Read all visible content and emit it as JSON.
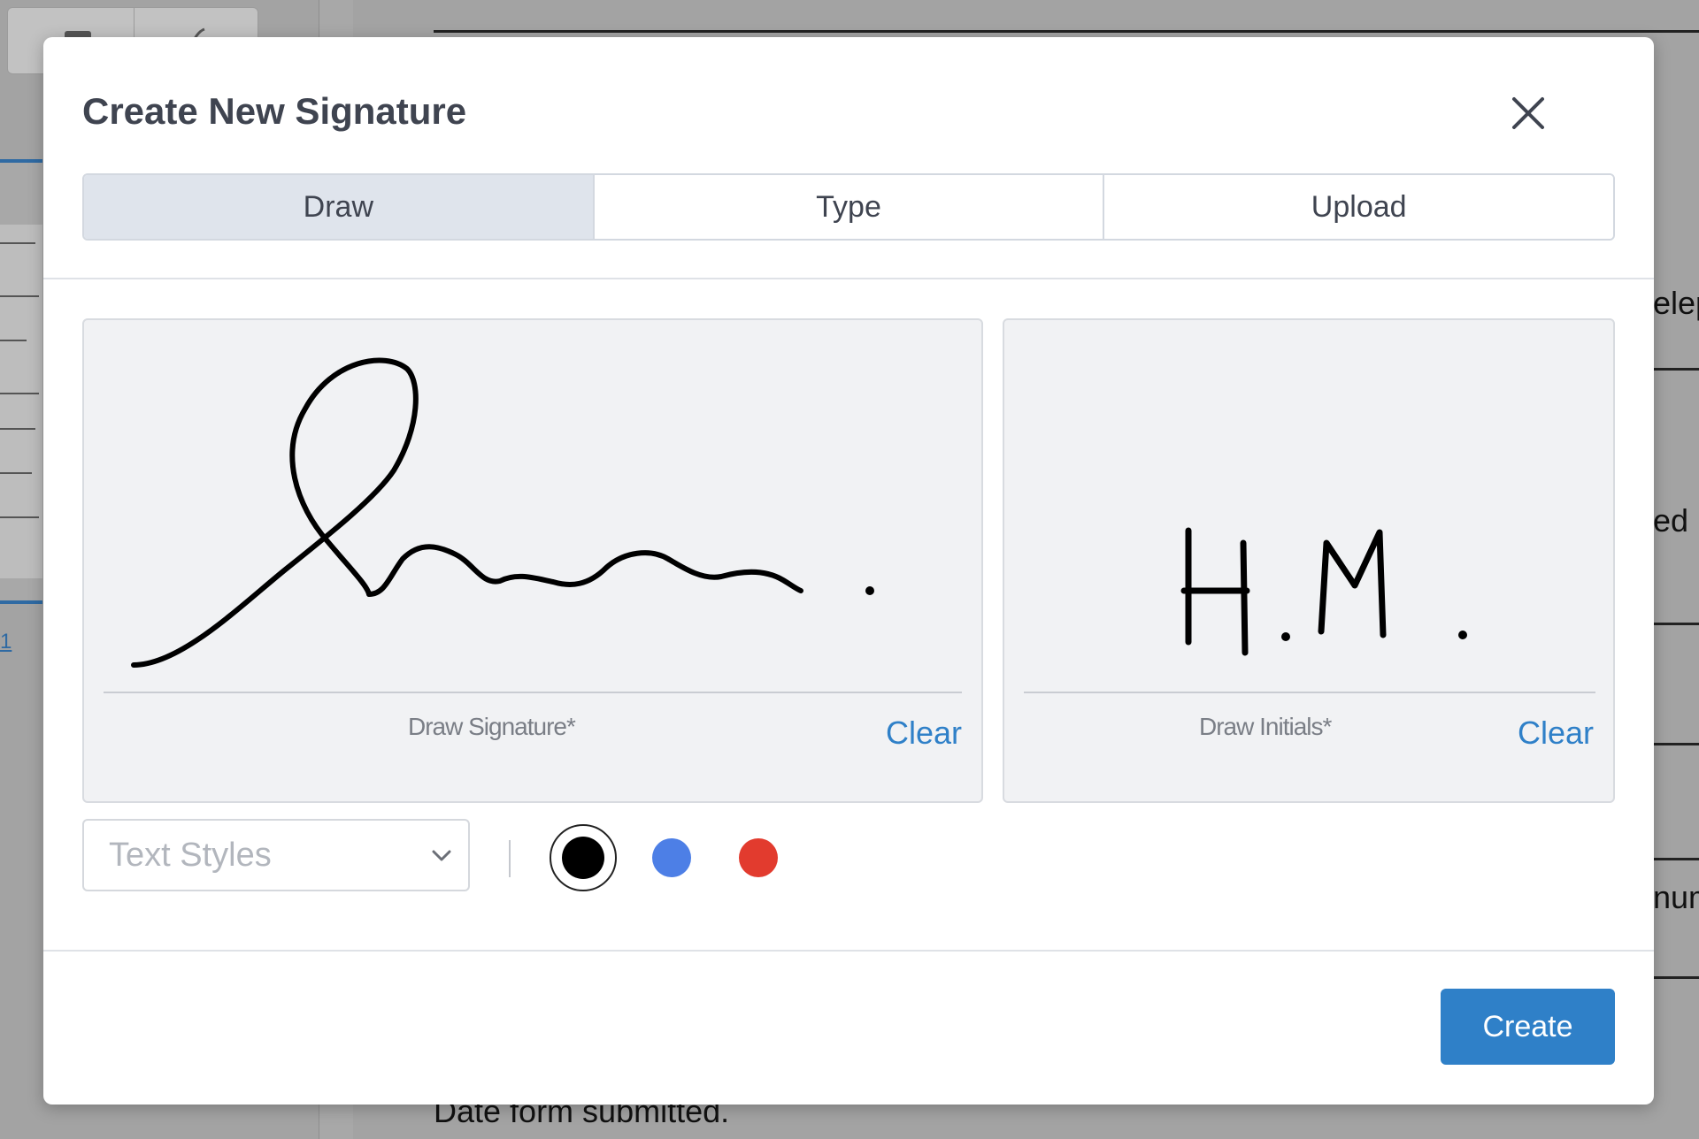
{
  "dialog": {
    "title": "Create New Signature",
    "close_icon": "close-icon"
  },
  "tabs": [
    {
      "label": "Draw",
      "active": true
    },
    {
      "label": "Type",
      "active": false
    },
    {
      "label": "Upload",
      "active": false
    }
  ],
  "signature_pad": {
    "label": "Draw Signature*",
    "clear_label": "Clear"
  },
  "initials_pad": {
    "label": "Draw Initials*",
    "clear_label": "Clear"
  },
  "text_styles": {
    "placeholder": "Text Styles",
    "icon": "chevron-down-icon"
  },
  "ink_colors": [
    {
      "name": "black",
      "hex": "#000000",
      "selected": true
    },
    {
      "name": "blue",
      "hex": "#4d7fe6",
      "selected": false
    },
    {
      "name": "red",
      "hex": "#e23b2e",
      "selected": false
    }
  ],
  "create_label": "Create",
  "background": {
    "right_fragments": [
      "elep",
      "ed",
      "num"
    ],
    "footer_text": "Date form submitted.",
    "page_number": "1"
  }
}
